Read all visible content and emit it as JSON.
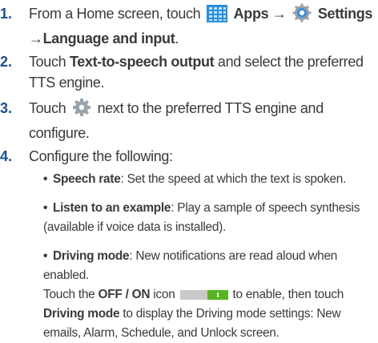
{
  "steps": [
    {
      "num": "1.",
      "p1": "From a Home screen, touch",
      "apps": "Apps",
      "arrow1": "→",
      "settings": "Settings",
      "arrow2": "→",
      "lang": "Language and input",
      "end": "."
    },
    {
      "num": "2.",
      "p1": "Touch",
      "tts": "Text-to-speech output",
      "p2": "and select the preferred",
      "line2": "TTS engine."
    },
    {
      "num": "3.",
      "p1": "Touch",
      "p2": "next to the preferred TTS engine and",
      "line2": "configure."
    },
    {
      "num": "4.",
      "p1": "Configure the following:"
    }
  ],
  "bullets": {
    "b1_label": "Speech rate",
    "b1_text": ": Set the speed at which the text is spoken.",
    "b2_label": "Listen to an example",
    "b2_text": ": Play a sample of speech synthesis",
    "b2_line2": "(available if voice data is installed).",
    "b3_label": "Driving mode",
    "b3_text": ": New notifications are read aloud when enabled.",
    "b3_l2a": "Touch the",
    "b3_offon": "OFF / ON",
    "b3_l2b": "icon",
    "b3_l2c": "to enable, then touch",
    "b3_l3_bold": "Driving mode",
    "b3_l3": "to display the Driving mode settings: New",
    "b3_l4": "emails, Alarm, Schedule, and Unlock screen."
  },
  "icons": {
    "apps": "apps-grid-icon",
    "settings": "settings-gear-icon",
    "engine": "engine-settings-icon",
    "toggle": "on-off-toggle-icon"
  },
  "colors": {
    "number": "#1f4e8c",
    "toggle_on": "#58b320",
    "apps_icon": "#2a8fd6"
  }
}
